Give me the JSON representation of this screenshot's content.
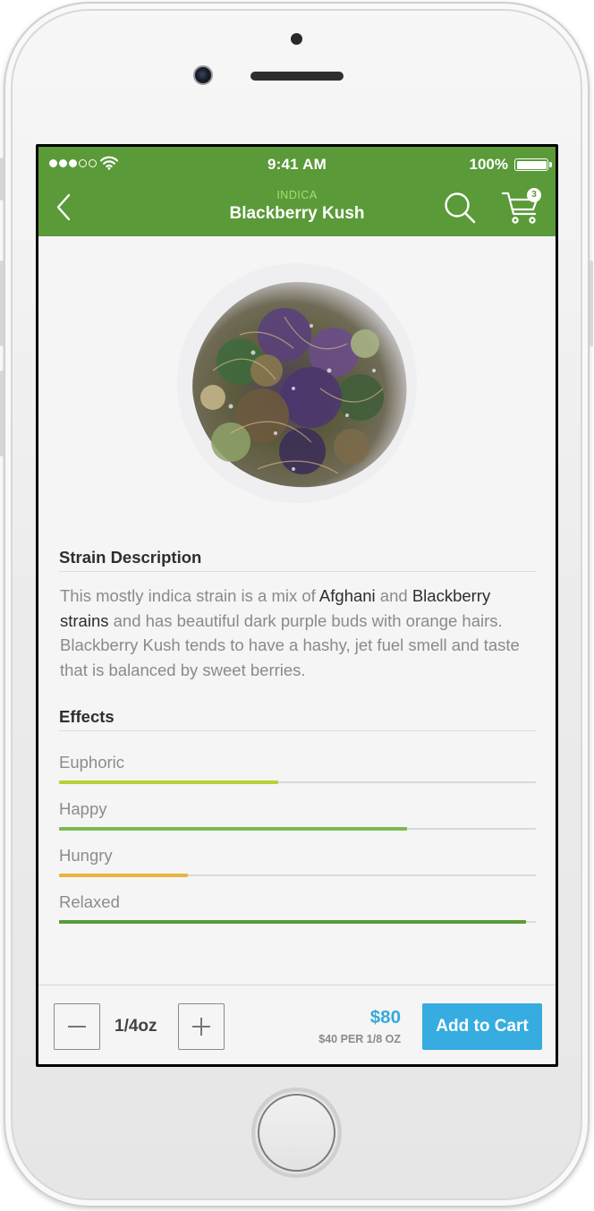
{
  "status_bar": {
    "time": "9:41 AM",
    "battery": "100%"
  },
  "nav": {
    "subtitle": "INDICA",
    "title": "Blackberry Kush",
    "cart_count": "3"
  },
  "strain_description": {
    "heading": "Strain Description",
    "segments": [
      {
        "text": "This mostly indica strain is a mix of ",
        "highlight": false
      },
      {
        "text": "Afghani",
        "highlight": true
      },
      {
        "text": " and ",
        "highlight": false
      },
      {
        "text": "Blackberry strains",
        "highlight": true
      },
      {
        "text": " and has beautiful dark purple buds with orange hairs. Blackberry Kush tends to have a hashy, jet fuel smell and taste that is balanced by sweet berries.",
        "highlight": false
      }
    ]
  },
  "effects": {
    "heading": "Effects",
    "items": [
      {
        "label": "Euphoric",
        "level": 0.46,
        "color": "#b5d334"
      },
      {
        "label": "Happy",
        "level": 0.73,
        "color": "#7cbb4e"
      },
      {
        "label": "Hungry",
        "level": 0.27,
        "color": "#e8b43e"
      },
      {
        "label": "Relaxed",
        "level": 0.98,
        "color": "#5a9a38"
      }
    ]
  },
  "purchase": {
    "quantity": "1/4oz",
    "price": "$80",
    "price_note": "$40 PER 1/8 OZ",
    "add_to_cart_label": "Add to Cart"
  },
  "colors": {
    "brand_green": "#5a9a38",
    "accent_blue": "#36ace0"
  },
  "icons": {
    "back": "chevron-left-icon",
    "search": "search-icon",
    "cart": "cart-icon",
    "minus": "minus-icon",
    "plus": "plus-icon"
  }
}
